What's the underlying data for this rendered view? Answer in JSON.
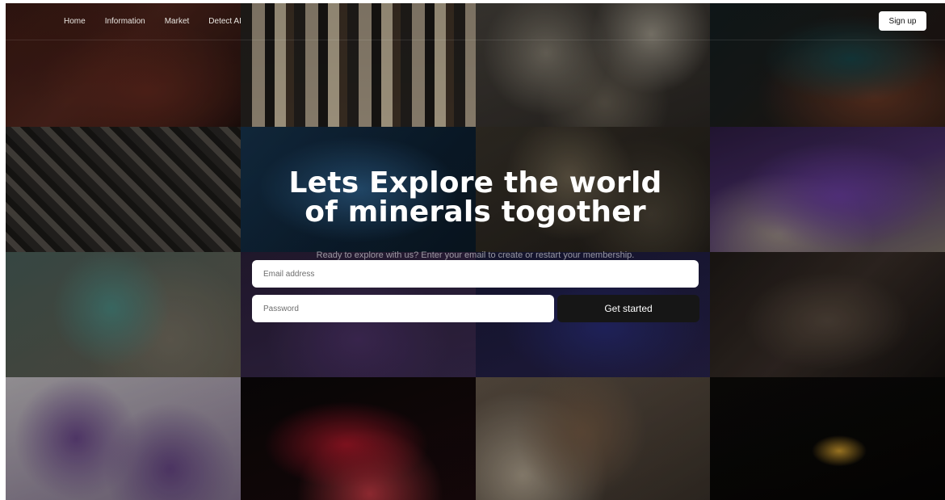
{
  "nav": {
    "links": [
      "Home",
      "Information",
      "Market",
      "Detect AI"
    ],
    "signup_label": "Sign up"
  },
  "hero": {
    "headline_line1": "Lets Explore the world",
    "headline_line2": "of minerals togother",
    "subtitle": "Ready to explore with us? Enter your email to create or restart your membership.",
    "email_placeholder": "Email address",
    "password_placeholder": "Password",
    "cta_label": "Get started"
  },
  "background_tiles": [
    "red-rock",
    "quartz-points",
    "granite",
    "blue-copper-crystal",
    "pyrite-cluster",
    "blue-crystal",
    "speckled-ore",
    "amethyst-geode",
    "teal-fluorite",
    "purple-crystal",
    "blue-violet-crystal",
    "dark-ore",
    "amethyst-gems",
    "red-crystal",
    "brown-quartz",
    "amber-crystal"
  ],
  "colors": {
    "signup_bg": "#ffffff",
    "cta_bg": "#161616",
    "text": "#ffffff"
  }
}
